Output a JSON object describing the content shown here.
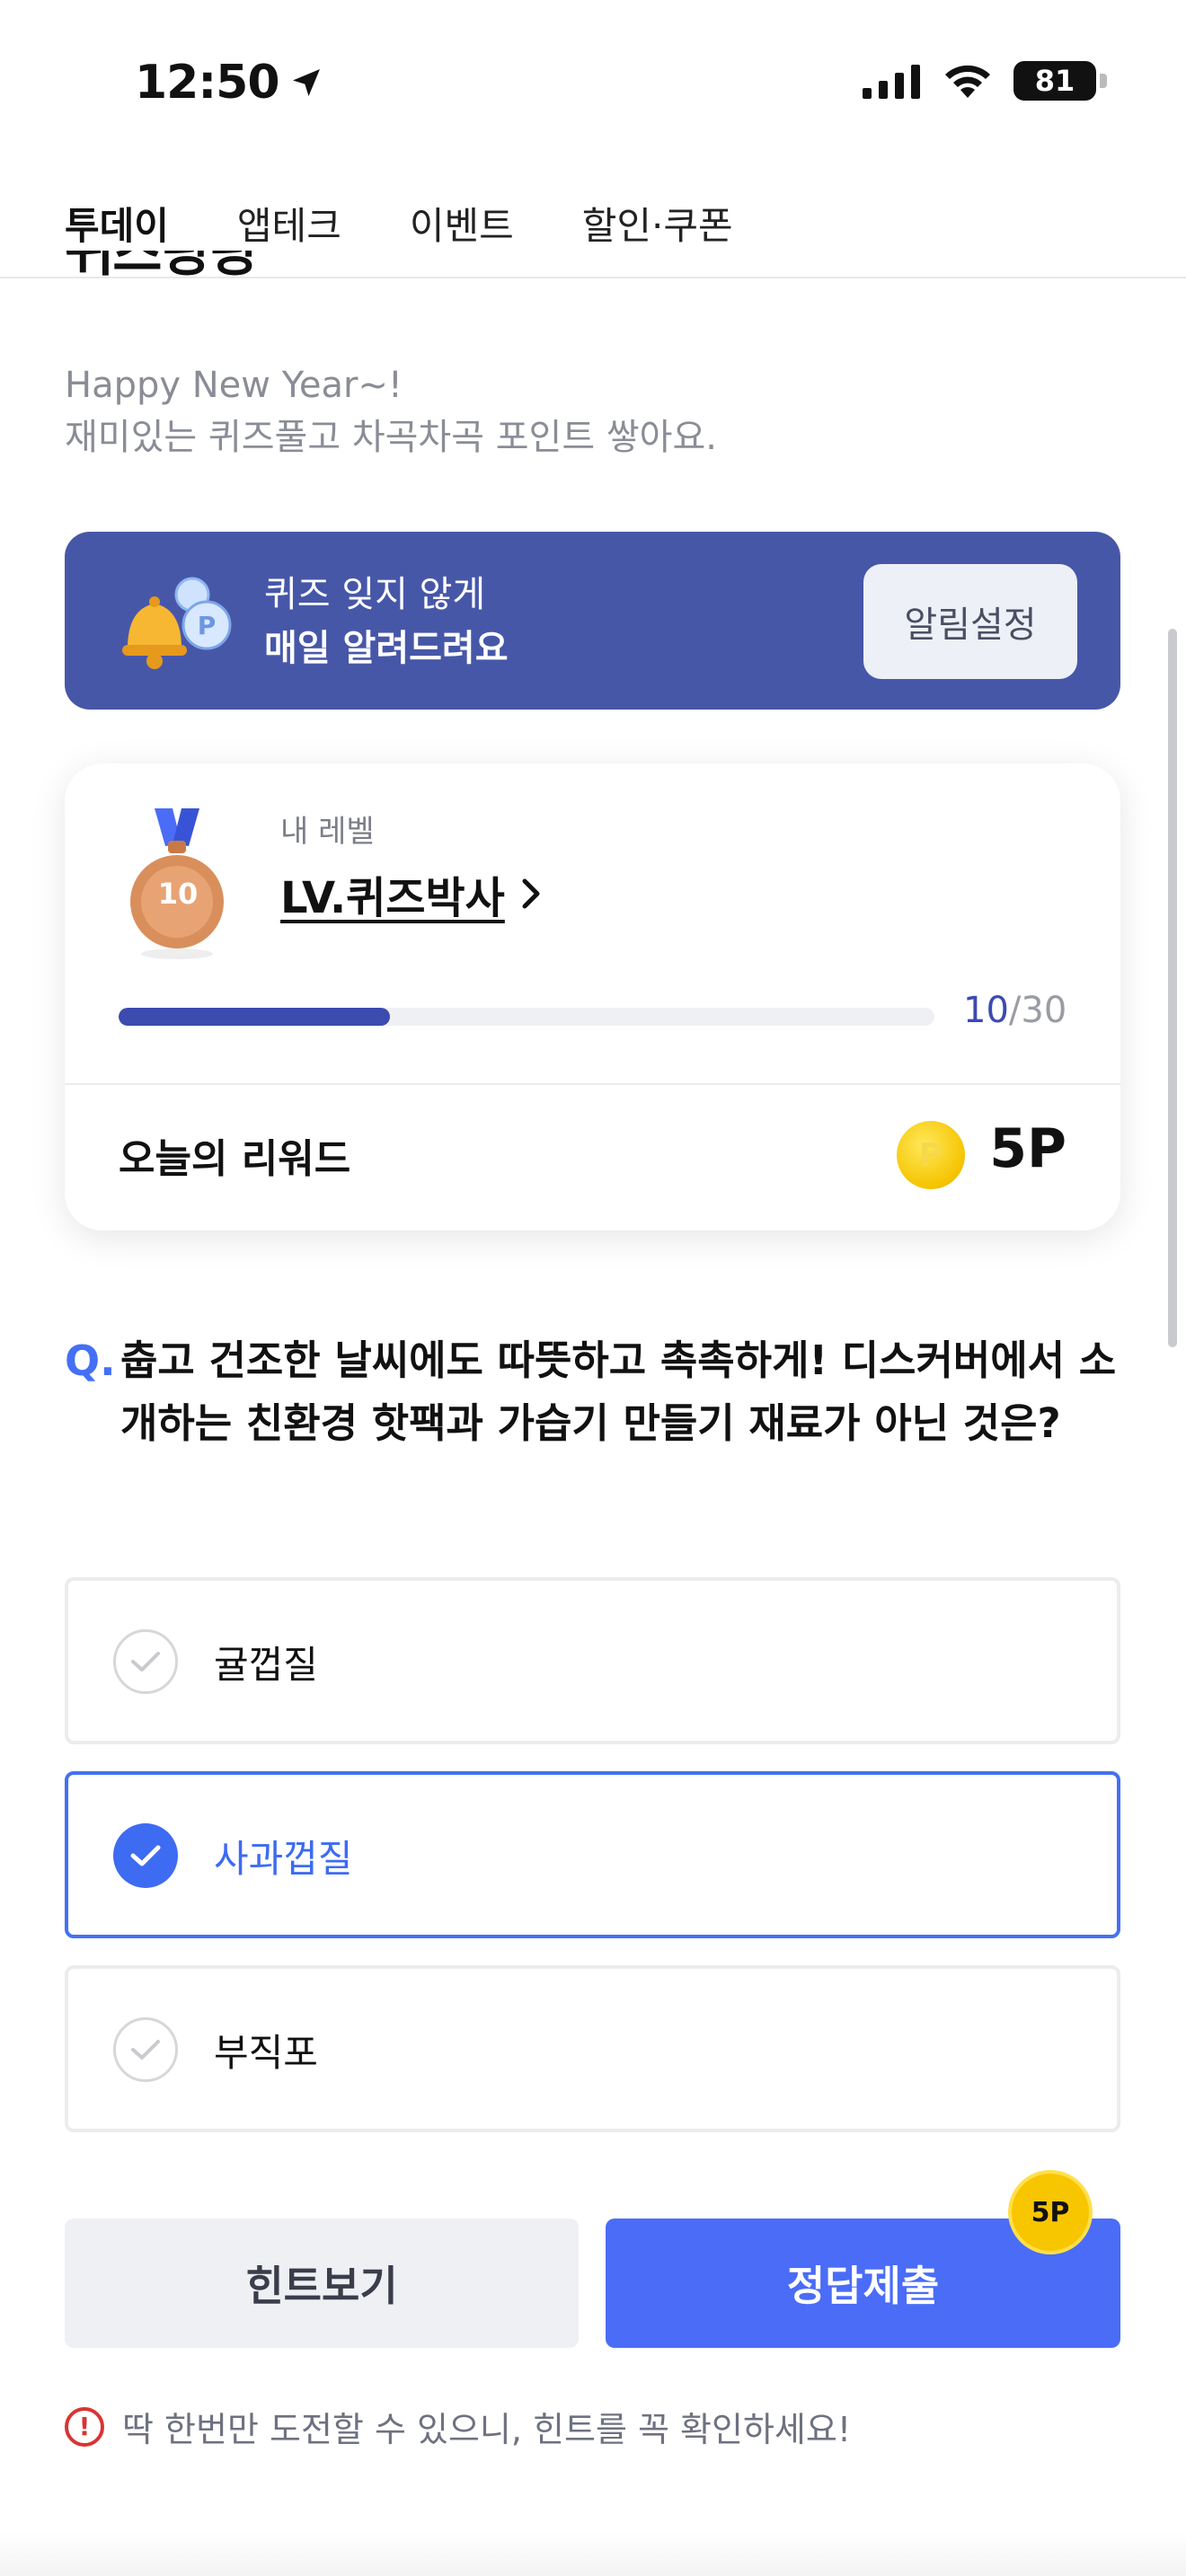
{
  "status_bar": {
    "time": "12:50",
    "battery": "81"
  },
  "tabs": [
    {
      "label": "투데이",
      "active": true
    },
    {
      "label": "앱테크"
    },
    {
      "label": "이벤트"
    },
    {
      "label": "할인·쿠폰"
    }
  ],
  "header": {
    "title_cut": "퀴즈링링",
    "subtitle_line1": "Happy New Year~!",
    "subtitle_line2": "재미있는 퀴즈풀고 차곡차곡 포인트 쌓아요."
  },
  "banner": {
    "line1": "퀴즈 잊지 않게",
    "line2": "매일 알려드려요",
    "button_label": "알림설정"
  },
  "level_card": {
    "caption": "내 레벨",
    "level_name": "LV.퀴즈박사",
    "medal_number": "10",
    "progress_current": "10",
    "progress_sep_total": "/30",
    "progress_fraction": 0.333,
    "reward_label": "오늘의 리워드",
    "reward_value": "5P",
    "coin_letter": "P"
  },
  "question": {
    "mark": "Q.",
    "text": "춥고 건조한 날씨에도 따뜻하고 촉촉하게! 디스커버에서 소개하는 친환경 핫팩과 가습기 만들기 재료가 아닌 것은?"
  },
  "options": [
    {
      "label": "귤껍질",
      "selected": false
    },
    {
      "label": "사과껍질",
      "selected": true
    },
    {
      "label": "부직포",
      "selected": false
    }
  ],
  "actions": {
    "hint_label": "힌트보기",
    "submit_label": "정답제출",
    "badge": "5P"
  },
  "warning": "딱 한번만 도전할 수 있으니, 힌트를 꼭 확인하세요!",
  "colors": {
    "accent": "#4A6CF7",
    "banner": "#4757A8",
    "progress": "#3B4BB0"
  }
}
